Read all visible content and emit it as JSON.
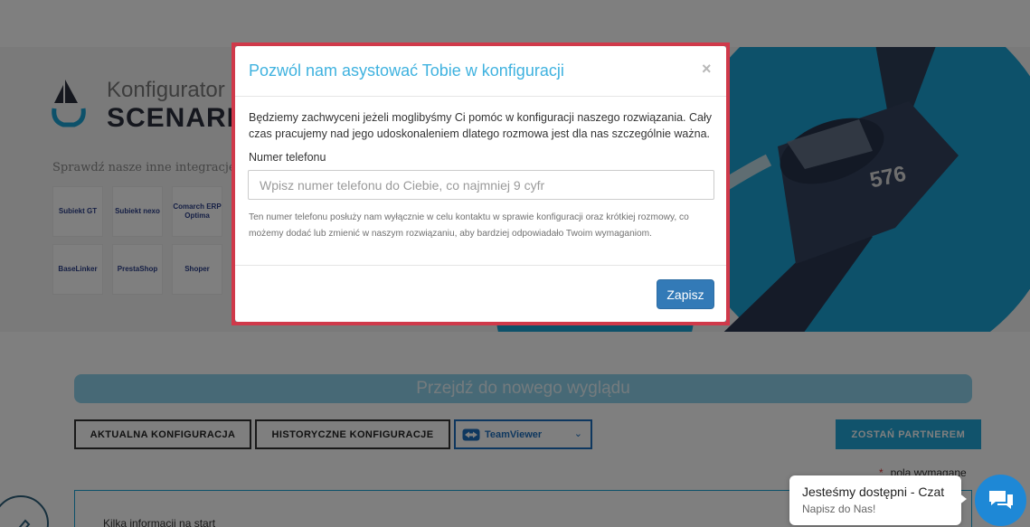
{
  "background": {
    "brand": {
      "line1": "Konfigurator",
      "line2": "SCENARI"
    },
    "integrations_title": "Sprawdź nasze inne integracje",
    "integrations": [
      {
        "label": "Subiekt GT"
      },
      {
        "label": "Subiekt nexo"
      },
      {
        "label": "Comarch ERP Optima"
      },
      {
        "label": "BaseLinker"
      },
      {
        "label": "PrestaShop"
      },
      {
        "label": "Shoper"
      }
    ],
    "plane_number": "576",
    "new_look_label": "Przejdź do nowego wyglądu",
    "tabs": {
      "current": "AKTUALNA KONFIGURACJA",
      "history": "HISTORYCZNE KONFIGURACJE"
    },
    "teamviewer_label": "TeamViewer",
    "partner_label": "ZOSTAŃ PARTNEREM",
    "required_star": "*",
    "required_note": "pola wymagane",
    "info_start": "Kilka informacji na start"
  },
  "modal": {
    "title": "Pozwól nam asystować Tobie w konfiguracji",
    "close_glyph": "×",
    "description": "Będziemy zachwyceni jeżeli moglibyśmy Ci pomóc w konfiguracji naszego rozwiązania. Cały czas pracujemy nad jego udoskonaleniem dlatego rozmowa jest dla nas szczególnie ważna.",
    "phone_label": "Numer telefonu",
    "phone_placeholder": "Wpisz numer telefonu do Ciebie, co najmniej 9 cyfr",
    "phone_value": "",
    "phone_help": "Ten numer telefonu posłuży nam wyłącznie w celu kontaktu w sprawie konfiguracji oraz krótkiej rozmowy, co możemy dodać lub zmienić w naszym rozwiązaniu, aby bardziej odpowiadało Twoim wymaganiom.",
    "save_label": "Zapisz",
    "highlight_color": "#d0394a"
  },
  "chat": {
    "title": "Jesteśmy dostępni - Czat",
    "subtitle": "Napisz do Nas!"
  },
  "colors": {
    "accent": "#1aa3d4",
    "modal_title": "#3fb2df",
    "save_button": "#337ab7",
    "chat_button": "#1e88d6"
  },
  "icons": {
    "close": "close-icon",
    "chat": "chat-icon",
    "teamviewer": "teamviewer-icon",
    "chevron": "chevron-down-icon",
    "pen": "pen-icon"
  }
}
